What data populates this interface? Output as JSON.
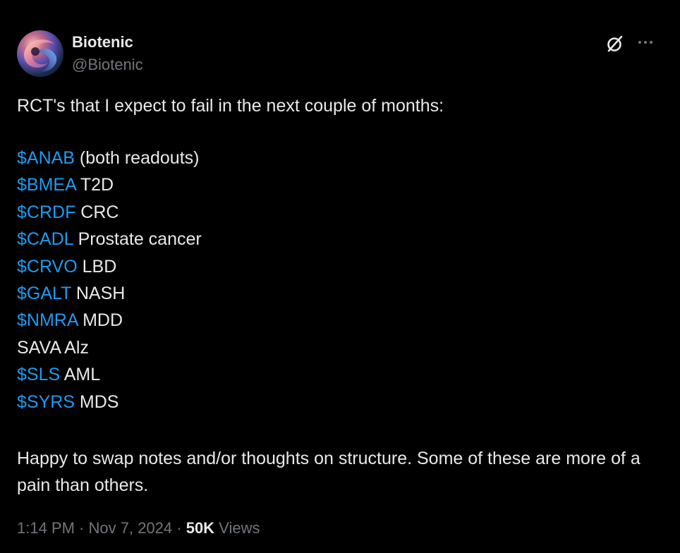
{
  "author": {
    "display_name": "Biotenic",
    "handle": "@Biotenic",
    "avatar_icon": "abstract-swirl-avatar"
  },
  "header_actions": {
    "grok_icon": "grok-slash-circle-icon",
    "more_icon": "more-dots-icon",
    "more_label": "···"
  },
  "tweet": {
    "intro": "RCT's that I expect to fail in the next couple of months:",
    "tickers": [
      {
        "cashtag": "$ANAB",
        "note": " (both readouts)"
      },
      {
        "cashtag": "$BMEA",
        "note": " T2D"
      },
      {
        "cashtag": "$CRDF",
        "note": " CRC"
      },
      {
        "cashtag": "$CADL",
        "note": " Prostate cancer"
      },
      {
        "cashtag": "$CRVO",
        "note": " LBD"
      },
      {
        "cashtag": "$GALT",
        "note": " NASH"
      },
      {
        "cashtag": "$NMRA",
        "note": " MDD"
      },
      {
        "cashtag": "",
        "note": "SAVA Alz"
      },
      {
        "cashtag": "$SLS",
        "note": " AML"
      },
      {
        "cashtag": "$SYRS",
        "note": " MDS"
      }
    ],
    "closing": "Happy to swap notes and/or thoughts on structure. Some of these are more of a pain than others."
  },
  "meta": {
    "time": "1:14 PM",
    "separator": " · ",
    "date": "Nov 7, 2024",
    "views_count": "50K",
    "views_label": " Views"
  },
  "colors": {
    "background": "#000000",
    "text": "#e7e9ea",
    "secondary": "#71767b",
    "cashtag": "#1d9bf0"
  }
}
